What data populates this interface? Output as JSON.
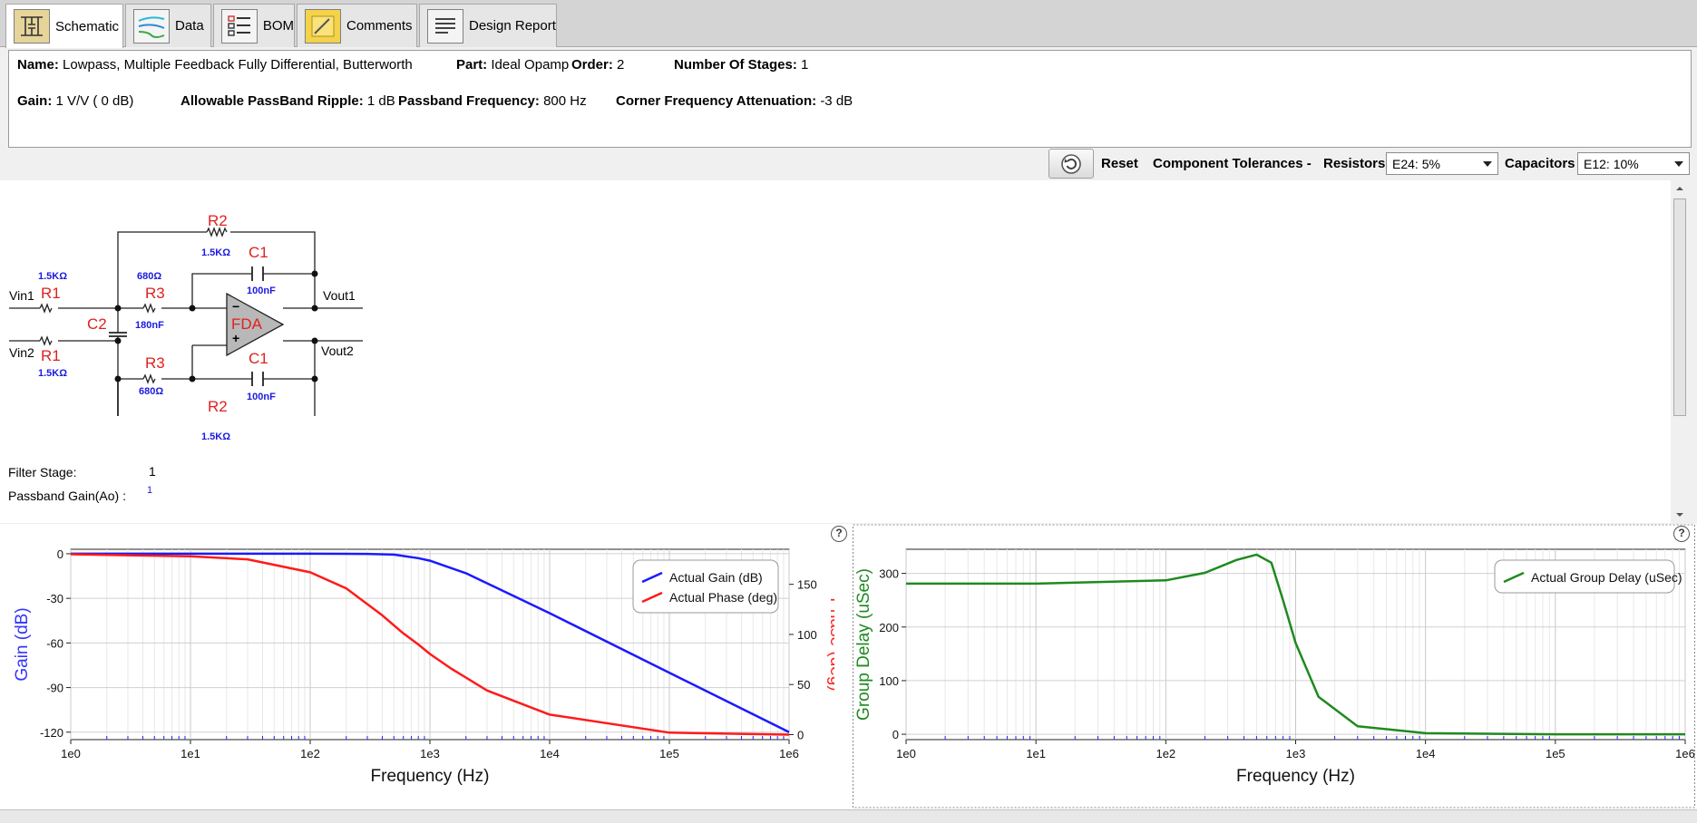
{
  "tabs": [
    {
      "label": "Schematic",
      "icon": "schematic-icon",
      "active": true
    },
    {
      "label": "Data",
      "icon": "data-chart-icon",
      "active": false
    },
    {
      "label": "BOM",
      "icon": "bom-list-icon",
      "active": false
    },
    {
      "label": "Comments",
      "icon": "comments-note-icon",
      "active": false
    },
    {
      "label": "Design Report",
      "icon": "report-icon",
      "active": false
    }
  ],
  "info": {
    "name_label": "Name:",
    "name": "Lowpass, Multiple Feedback Fully Differential, Butterworth",
    "part_label": "Part:",
    "part": "Ideal Opamp",
    "order_label": "Order:",
    "order": "2",
    "stages_label": "Number Of Stages:",
    "stages": "1",
    "gain_label": "Gain:",
    "gain": "1 V/V ( 0 dB)",
    "ripple_label": "Allowable PassBand Ripple:",
    "ripple": "1 dB",
    "passband_label": "Passband Frequency:",
    "passband": "800 Hz",
    "corner_label": "Corner Frequency Attenuation:",
    "corner": "-3 dB"
  },
  "toolbar": {
    "reset": "Reset",
    "tolerances": "Component Tolerances -",
    "resistors_label": "Resistors",
    "resistors_value": "E24: 5%",
    "capacitors_label": "Capacitors",
    "capacitors_value": "E12: 10%"
  },
  "schematic": {
    "r2_top": "R2",
    "r2_top_val": "1.5KΩ",
    "c1_top": "C1",
    "c1_top_val": "100nF",
    "r1_top_val": "1.5KΩ",
    "r1_top": "R1",
    "r3_top_val": "680Ω",
    "r3_top": "R3",
    "vin1": "Vin1",
    "vin2": "Vin2",
    "c2": "C2",
    "c2_val": "180nF",
    "fda": "FDA",
    "minus": "−",
    "plus": "+",
    "vout1": "Vout1",
    "vout2": "Vout2",
    "r1_bot": "R1",
    "r1_bot_val": "1.5KΩ",
    "r3_bot": "R3",
    "r3_bot_val": "680Ω",
    "c1_bot": "C1",
    "c1_bot_val": "100nF",
    "r2_bot": "R2",
    "r2_bot_val": "1.5KΩ",
    "stage_label": "Filter Stage:",
    "stage_value": "1",
    "ao_label": "Passband Gain(Ao) :",
    "ao_value": "1"
  },
  "chart_data": [
    {
      "type": "line",
      "xlabel": "Frequency (Hz)",
      "ylabel": "Gain (dB)",
      "y2label": "Phase (deg)",
      "xscale": "log",
      "xlim": [
        1,
        1000000
      ],
      "xticks": [
        "1e0",
        "1e1",
        "1e2",
        "1e3",
        "1e4",
        "1e5",
        "1e6"
      ],
      "ylim": [
        -125,
        3
      ],
      "yticks": [
        0,
        -30,
        -60,
        -90,
        -120
      ],
      "y2lim": [
        -5,
        185
      ],
      "y2ticks": [
        0,
        50,
        100,
        150
      ],
      "grid": true,
      "legend": "top-right",
      "series": [
        {
          "name": "Actual Gain (dB)",
          "axis": "left",
          "color": "#1a1aff",
          "x": [
            1,
            10,
            100,
            300,
            500,
            800,
            1000,
            2000,
            5000,
            10000,
            100000,
            1000000
          ],
          "y": [
            0,
            0,
            0,
            -0.1,
            -0.6,
            -3,
            -4.7,
            -13.1,
            -28.4,
            -40,
            -80,
            -120
          ]
        },
        {
          "name": "Actual Phase (deg)",
          "axis": "right",
          "color": "#ff1a1a",
          "x": [
            1,
            10,
            30,
            100,
            200,
            400,
            600,
            800,
            1000,
            1500,
            3000,
            10000,
            100000,
            1000000
          ],
          "y": [
            180,
            178,
            175,
            162,
            146,
            119,
            101,
            90,
            80.5,
            66,
            44,
            20,
            2,
            0
          ]
        }
      ]
    },
    {
      "type": "line",
      "xlabel": "Frequency (Hz)",
      "ylabel": "Group Delay (uSec)",
      "xscale": "log",
      "xlim": [
        1,
        1000000
      ],
      "xticks": [
        "1e0",
        "1e1",
        "1e2",
        "1e3",
        "1e4",
        "1e5",
        "1e6"
      ],
      "ylim": [
        -10,
        345
      ],
      "yticks": [
        0,
        100,
        200,
        300
      ],
      "grid": true,
      "legend": "top-right",
      "series": [
        {
          "name": "Actual Group Delay (uSec)",
          "color": "#1f8a1f",
          "x": [
            1,
            10,
            100,
            200,
            350,
            500,
            650,
            800,
            1000,
            1500,
            3000,
            10000,
            100000,
            1000000
          ],
          "y": [
            281,
            281,
            287,
            301,
            325,
            335,
            320,
            250,
            170,
            70,
            15,
            2,
            0,
            0
          ]
        }
      ]
    }
  ],
  "help_icon": "?"
}
